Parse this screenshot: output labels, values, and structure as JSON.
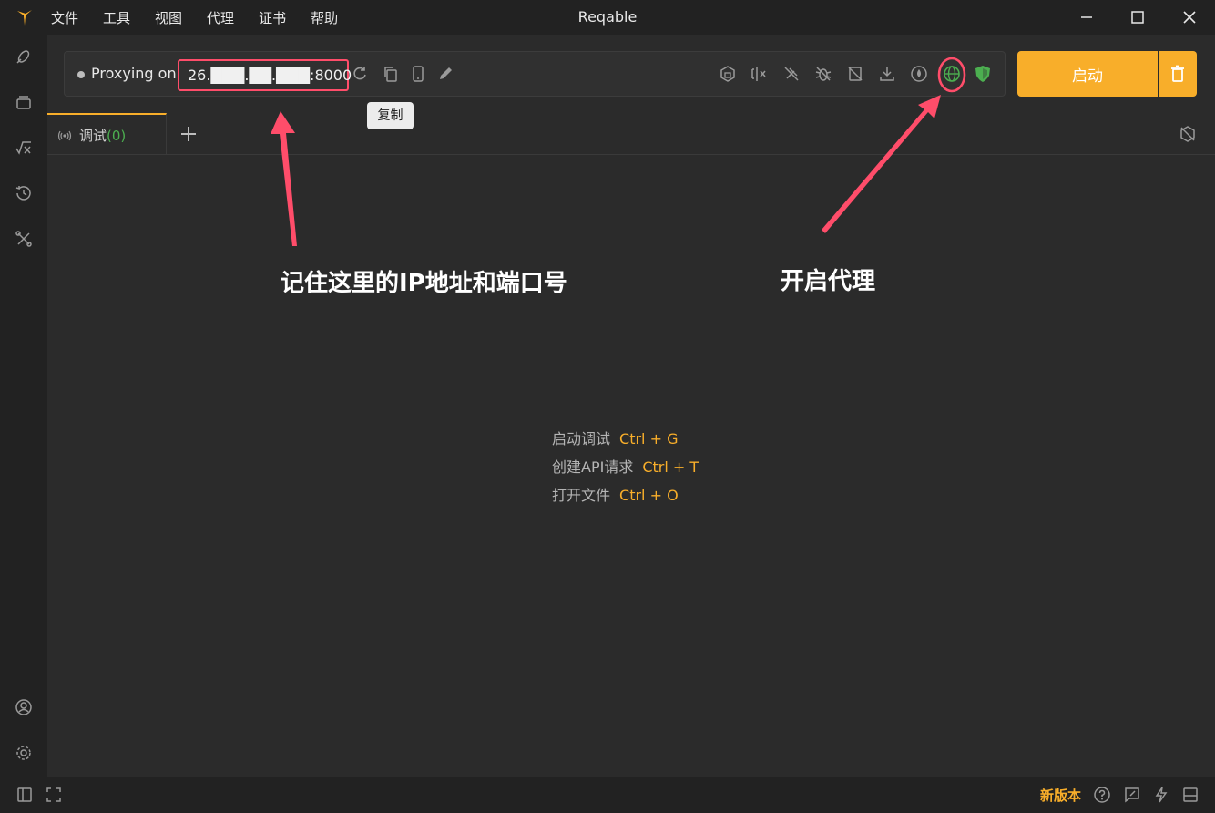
{
  "window": {
    "title": "Reqable",
    "menu": [
      "文件",
      "工具",
      "视图",
      "代理",
      "证书",
      "帮助"
    ]
  },
  "proxy": {
    "label": "Proxying on",
    "address": "26.███.██.███:8000",
    "copy_tooltip": "复制",
    "start_label": "启动"
  },
  "tabs": {
    "debug_label": "调试",
    "debug_count": "(0)"
  },
  "shortcuts": [
    {
      "label": "启动调试",
      "key": "Ctrl + G"
    },
    {
      "label": "创建API请求",
      "key": "Ctrl + T"
    },
    {
      "label": "打开文件",
      "key": "Ctrl + O"
    }
  ],
  "annotations": {
    "ip_note": "记住这里的IP地址和端口号",
    "proxy_note": "开启代理"
  },
  "bottom": {
    "new_version": "新版本"
  },
  "colors": {
    "accent": "#f8ae2a",
    "annotation": "#ff4d6a",
    "success": "#4caf50"
  }
}
